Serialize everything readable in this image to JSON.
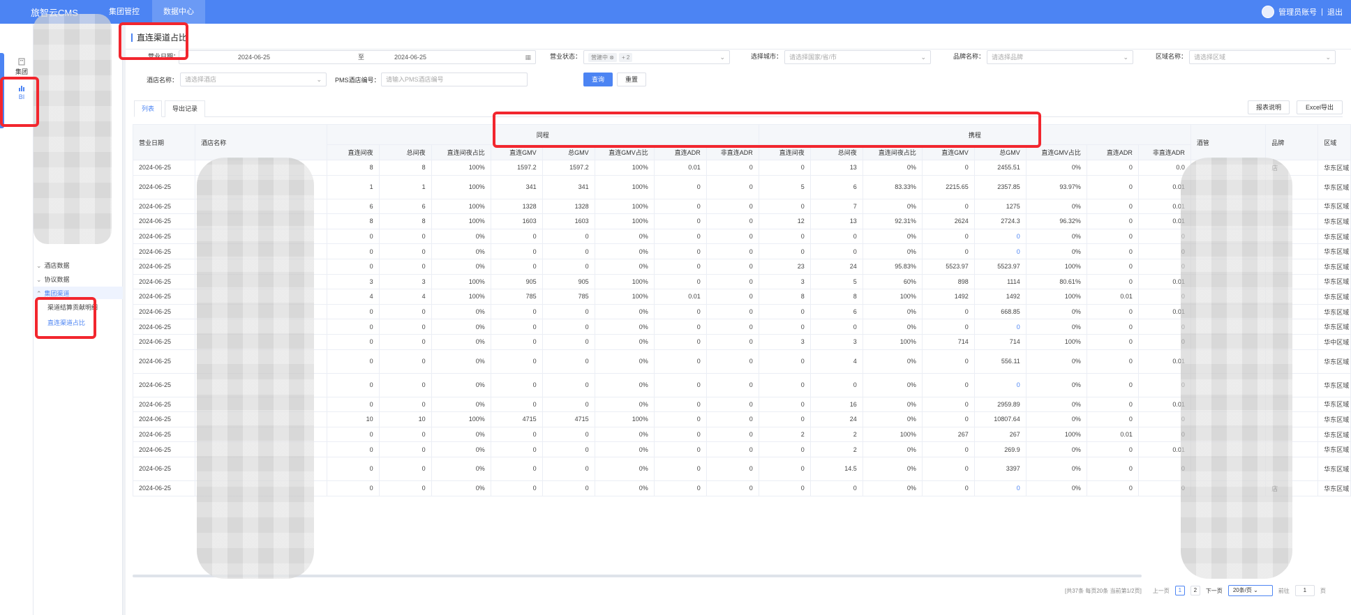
{
  "app": {
    "brand": "旅智云CMS",
    "nav": [
      {
        "label": "集团管控"
      },
      {
        "label": "数据中心"
      }
    ],
    "user": "管理员账号",
    "logout": "退出"
  },
  "rail": {
    "items": [
      {
        "label": "集团",
        "icon": "building-icon"
      },
      {
        "label": "BI",
        "icon": "chart-icon"
      }
    ]
  },
  "submenu": {
    "items": [
      {
        "label": "酒店数据"
      },
      {
        "label": "协议数据"
      },
      {
        "label": "集团渠道"
      },
      {
        "label": "渠道结算贡献明细"
      },
      {
        "label": "直连渠道占比"
      }
    ]
  },
  "page": {
    "title": "直连渠道占比"
  },
  "filters": {
    "business_date_label": "营业日期：",
    "date_from": "2024-06-25",
    "date_sep": "至",
    "date_to": "2024-06-25",
    "status_label": "营业状态：",
    "status_tag": "营建中",
    "status_more": "+ 2",
    "city_label": "选择城市：",
    "city_placeholder": "请选择国家/省/市",
    "brand_label": "品牌名称：",
    "brand_placeholder": "请选择品牌",
    "region_label": "区域名称：",
    "region_placeholder": "请选择区域",
    "hotel_label": "酒店名称：",
    "hotel_placeholder": "请选择酒店",
    "pms_label": "PMS酒店编号：",
    "pms_placeholder": "请输入PMS酒店编号",
    "query_btn": "查询",
    "reset_btn": "重置"
  },
  "tabs": [
    {
      "label": "列表"
    },
    {
      "label": "导出记录"
    }
  ],
  "actions": {
    "report_desc": "报表说明",
    "excel_export": "Excel导出"
  },
  "table": {
    "col_date": "营业日期",
    "col_hotel": "酒店名称",
    "group_a": "同程",
    "group_b": "携程",
    "sub_headers": [
      "直连间夜",
      "总间夜",
      "直连间夜占比",
      "直连GMV",
      "总GMV",
      "直连GMV占比",
      "直连ADR",
      "非直连ADR"
    ],
    "col_manager": "酒管",
    "col_brand": "品牌",
    "col_region": "区域",
    "rows": [
      {
        "date": "2024-06-25",
        "a": [
          "8",
          "8",
          "100%",
          "1597.2",
          "1597.2",
          "100%",
          "0.01",
          "0"
        ],
        "b": [
          "0",
          "13",
          "0%",
          "0",
          "2455.51",
          "0%",
          "0",
          "0.0"
        ],
        "brand": "店",
        "region": "华东区域"
      },
      {
        "date": "2024-06-25",
        "a": [
          "1",
          "1",
          "100%",
          "341",
          "341",
          "100%",
          "0",
          "0"
        ],
        "b": [
          "5",
          "6",
          "83.33%",
          "2215.65",
          "2357.85",
          "93.97%",
          "0",
          "0.01"
        ],
        "brand": "",
        "region": "华东区域"
      },
      {
        "date": "2024-06-25",
        "a": [
          "6",
          "6",
          "100%",
          "1328",
          "1328",
          "100%",
          "0",
          "0"
        ],
        "b": [
          "0",
          "7",
          "0%",
          "0",
          "1275",
          "0%",
          "0",
          "0.01"
        ],
        "brand": "",
        "region": "华东区域"
      },
      {
        "date": "2024-06-25",
        "a": [
          "8",
          "8",
          "100%",
          "1603",
          "1603",
          "100%",
          "0",
          "0"
        ],
        "b": [
          "12",
          "13",
          "92.31%",
          "2624",
          "2724.3",
          "96.32%",
          "0",
          "0.01"
        ],
        "brand": "",
        "region": "华东区域"
      },
      {
        "date": "2024-06-25",
        "a": [
          "0",
          "0",
          "0%",
          "0",
          "0",
          "0%",
          "0",
          "0"
        ],
        "b": [
          "0",
          "0",
          "0%",
          "0",
          "0",
          "0%",
          "0",
          "0"
        ],
        "brand": "",
        "region": "华东区域"
      },
      {
        "date": "2024-06-25",
        "a": [
          "0",
          "0",
          "0%",
          "0",
          "0",
          "0%",
          "0",
          "0"
        ],
        "b": [
          "0",
          "0",
          "0%",
          "0",
          "0",
          "0%",
          "0",
          "0"
        ],
        "brand": "",
        "region": "华东区域"
      },
      {
        "date": "2024-06-25",
        "a": [
          "0",
          "0",
          "0%",
          "0",
          "0",
          "0%",
          "0",
          "0"
        ],
        "b": [
          "23",
          "24",
          "95.83%",
          "5523.97",
          "5523.97",
          "100%",
          "0",
          "0"
        ],
        "brand": "",
        "region": "华东区域"
      },
      {
        "date": "2024-06-25",
        "a": [
          "3",
          "3",
          "100%",
          "905",
          "905",
          "100%",
          "0",
          "0"
        ],
        "b": [
          "3",
          "5",
          "60%",
          "898",
          "1114",
          "80.61%",
          "0",
          "0.01"
        ],
        "brand": "",
        "region": "华东区域"
      },
      {
        "date": "2024-06-25",
        "a": [
          "4",
          "4",
          "100%",
          "785",
          "785",
          "100%",
          "0.01",
          "0"
        ],
        "b": [
          "8",
          "8",
          "100%",
          "1492",
          "1492",
          "100%",
          "0.01",
          "0"
        ],
        "brand": "",
        "region": "华东区域"
      },
      {
        "date": "2024-06-25",
        "a": [
          "0",
          "0",
          "0%",
          "0",
          "0",
          "0%",
          "0",
          "0"
        ],
        "b": [
          "0",
          "6",
          "0%",
          "0",
          "668.85",
          "0%",
          "0",
          "0.01"
        ],
        "brand": "",
        "region": "华东区域"
      },
      {
        "date": "2024-06-25",
        "a": [
          "0",
          "0",
          "0%",
          "0",
          "0",
          "0%",
          "0",
          "0"
        ],
        "b": [
          "0",
          "0",
          "0%",
          "0",
          "0",
          "0%",
          "0",
          "0"
        ],
        "brand": "",
        "region": "华东区域"
      },
      {
        "date": "2024-06-25",
        "a": [
          "0",
          "0",
          "0%",
          "0",
          "0",
          "0%",
          "0",
          "0"
        ],
        "b": [
          "3",
          "3",
          "100%",
          "714",
          "714",
          "100%",
          "0",
          "0"
        ],
        "brand": "",
        "region": "华中区域"
      },
      {
        "date": "2024-06-25",
        "a": [
          "0",
          "0",
          "0%",
          "0",
          "0",
          "0%",
          "0",
          "0"
        ],
        "b": [
          "0",
          "4",
          "0%",
          "0",
          "556.11",
          "0%",
          "0",
          "0.01"
        ],
        "brand": "",
        "region": "华东区域"
      },
      {
        "date": "2024-06-25",
        "a": [
          "0",
          "0",
          "0%",
          "0",
          "0",
          "0%",
          "0",
          "0"
        ],
        "b": [
          "0",
          "0",
          "0%",
          "0",
          "0",
          "0%",
          "0",
          "0"
        ],
        "brand": "",
        "region": "华东区域"
      },
      {
        "date": "2024-06-25",
        "a": [
          "0",
          "0",
          "0%",
          "0",
          "0",
          "0%",
          "0",
          "0"
        ],
        "b": [
          "0",
          "16",
          "0%",
          "0",
          "2959.89",
          "0%",
          "0",
          "0.01"
        ],
        "brand": "",
        "region": "华东区域"
      },
      {
        "date": "2024-06-25",
        "a": [
          "10",
          "10",
          "100%",
          "4715",
          "4715",
          "100%",
          "0",
          "0"
        ],
        "b": [
          "0",
          "24",
          "0%",
          "0",
          "10807.64",
          "0%",
          "0",
          "0"
        ],
        "brand": "",
        "region": "华东区域"
      },
      {
        "date": "2024-06-25",
        "a": [
          "0",
          "0",
          "0%",
          "0",
          "0",
          "0%",
          "0",
          "0"
        ],
        "b": [
          "2",
          "2",
          "100%",
          "267",
          "267",
          "100%",
          "0.01",
          "0"
        ],
        "brand": "",
        "region": "华东区域"
      },
      {
        "date": "2024-06-25",
        "a": [
          "0",
          "0",
          "0%",
          "0",
          "0",
          "0%",
          "0",
          "0"
        ],
        "b": [
          "0",
          "2",
          "0%",
          "0",
          "269.9",
          "0%",
          "0",
          "0.01"
        ],
        "brand": "",
        "region": "华东区域"
      },
      {
        "date": "2024-06-25",
        "a": [
          "0",
          "0",
          "0%",
          "0",
          "0",
          "0%",
          "0",
          "0"
        ],
        "b": [
          "0",
          "14.5",
          "0%",
          "0",
          "3397",
          "0%",
          "0",
          "0"
        ],
        "brand": "",
        "region": "华东区域"
      },
      {
        "date": "2024-06-25",
        "a": [
          "0",
          "0",
          "0%",
          "0",
          "0",
          "0%",
          "0",
          "0"
        ],
        "b": [
          "0",
          "0",
          "0%",
          "0",
          "0",
          "0%",
          "0",
          "0"
        ],
        "brand": "店",
        "region": "华东区域"
      }
    ]
  },
  "pager": {
    "summary": "[共37条 每页20条 当前第1/2页]",
    "prev": "上一页",
    "pages": [
      "1",
      "2"
    ],
    "next": "下一页",
    "page_size": "20条/页",
    "goto": "前往",
    "goto_value": "1",
    "page_unit": "页"
  },
  "colors": {
    "accent": "#4c84f3",
    "highlight": "#f2262e"
  }
}
